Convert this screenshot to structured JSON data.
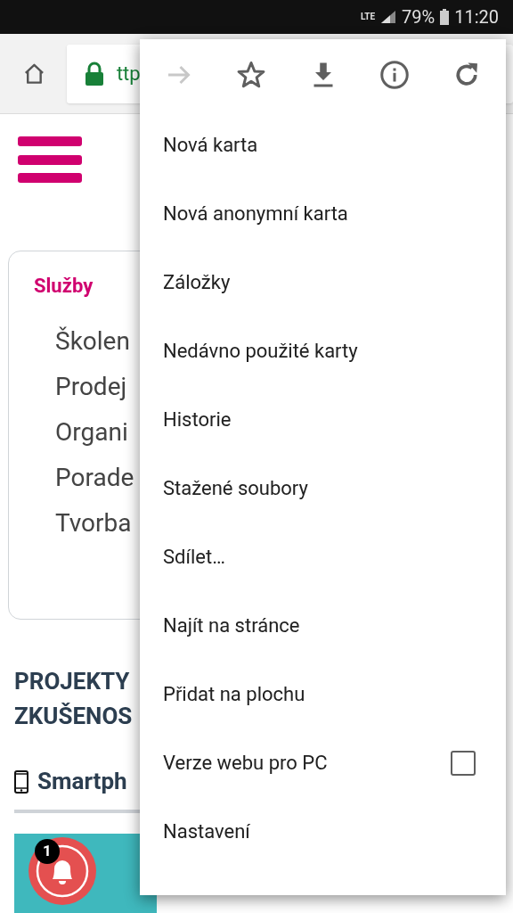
{
  "status_bar": {
    "network": "LTE",
    "battery": "79%",
    "time": "11:20"
  },
  "address_bar": {
    "url": "ttp"
  },
  "page": {
    "section_title": "Služby",
    "services": [
      "Školen",
      "Prodej",
      "Organi",
      "Porade",
      "Tvorba"
    ],
    "heading_lines": [
      "PROJEKTY",
      "ZKUŠENOS"
    ],
    "subheading": "Smartph",
    "notification_count": "1"
  },
  "menu": {
    "toolbar": [
      {
        "kind": "forward",
        "disabled": true
      },
      {
        "kind": "bookmark",
        "disabled": false
      },
      {
        "kind": "download",
        "disabled": false
      },
      {
        "kind": "info",
        "disabled": false
      },
      {
        "kind": "reload",
        "disabled": false
      }
    ],
    "items": [
      {
        "label": "Nová karta",
        "kind": "plain"
      },
      {
        "label": "Nová anonymní karta",
        "kind": "plain"
      },
      {
        "label": "Záložky",
        "kind": "plain"
      },
      {
        "label": "Nedávno použité karty",
        "kind": "plain"
      },
      {
        "label": "Historie",
        "kind": "plain"
      },
      {
        "label": "Stažené soubory",
        "kind": "plain"
      },
      {
        "label": "Sdílet…",
        "kind": "plain"
      },
      {
        "label": "Najít na stránce",
        "kind": "plain"
      },
      {
        "label": "Přidat na plochu",
        "kind": "plain"
      },
      {
        "label": "Verze webu pro PC",
        "kind": "checkbox",
        "checked": false
      },
      {
        "label": "Nastavení",
        "kind": "plain"
      }
    ]
  }
}
